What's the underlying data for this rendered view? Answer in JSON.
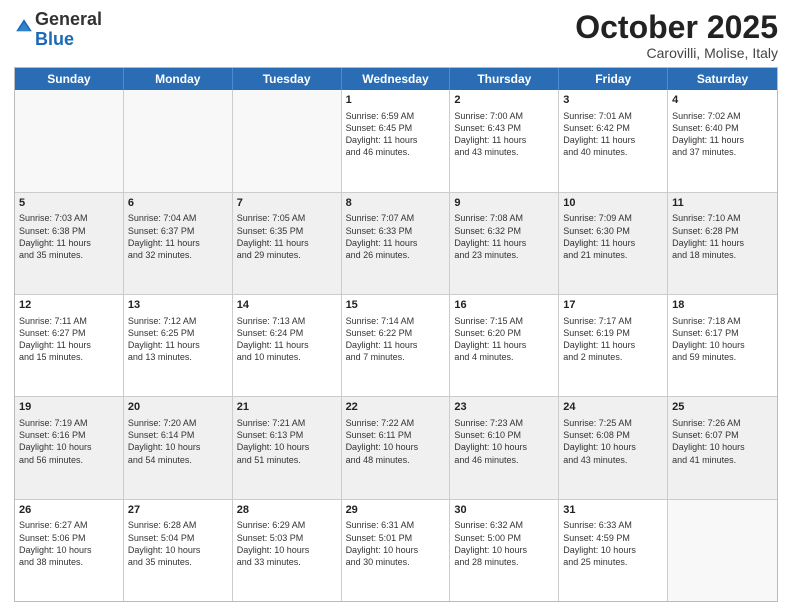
{
  "logo": {
    "general": "General",
    "blue": "Blue"
  },
  "header": {
    "month": "October 2025",
    "location": "Carovilli, Molise, Italy"
  },
  "weekdays": [
    "Sunday",
    "Monday",
    "Tuesday",
    "Wednesday",
    "Thursday",
    "Friday",
    "Saturday"
  ],
  "rows": [
    {
      "shaded": false,
      "cells": [
        {
          "day": "",
          "info": ""
        },
        {
          "day": "",
          "info": ""
        },
        {
          "day": "",
          "info": ""
        },
        {
          "day": "1",
          "info": "Sunrise: 6:59 AM\nSunset: 6:45 PM\nDaylight: 11 hours\nand 46 minutes."
        },
        {
          "day": "2",
          "info": "Sunrise: 7:00 AM\nSunset: 6:43 PM\nDaylight: 11 hours\nand 43 minutes."
        },
        {
          "day": "3",
          "info": "Sunrise: 7:01 AM\nSunset: 6:42 PM\nDaylight: 11 hours\nand 40 minutes."
        },
        {
          "day": "4",
          "info": "Sunrise: 7:02 AM\nSunset: 6:40 PM\nDaylight: 11 hours\nand 37 minutes."
        }
      ]
    },
    {
      "shaded": true,
      "cells": [
        {
          "day": "5",
          "info": "Sunrise: 7:03 AM\nSunset: 6:38 PM\nDaylight: 11 hours\nand 35 minutes."
        },
        {
          "day": "6",
          "info": "Sunrise: 7:04 AM\nSunset: 6:37 PM\nDaylight: 11 hours\nand 32 minutes."
        },
        {
          "day": "7",
          "info": "Sunrise: 7:05 AM\nSunset: 6:35 PM\nDaylight: 11 hours\nand 29 minutes."
        },
        {
          "day": "8",
          "info": "Sunrise: 7:07 AM\nSunset: 6:33 PM\nDaylight: 11 hours\nand 26 minutes."
        },
        {
          "day": "9",
          "info": "Sunrise: 7:08 AM\nSunset: 6:32 PM\nDaylight: 11 hours\nand 23 minutes."
        },
        {
          "day": "10",
          "info": "Sunrise: 7:09 AM\nSunset: 6:30 PM\nDaylight: 11 hours\nand 21 minutes."
        },
        {
          "day": "11",
          "info": "Sunrise: 7:10 AM\nSunset: 6:28 PM\nDaylight: 11 hours\nand 18 minutes."
        }
      ]
    },
    {
      "shaded": false,
      "cells": [
        {
          "day": "12",
          "info": "Sunrise: 7:11 AM\nSunset: 6:27 PM\nDaylight: 11 hours\nand 15 minutes."
        },
        {
          "day": "13",
          "info": "Sunrise: 7:12 AM\nSunset: 6:25 PM\nDaylight: 11 hours\nand 13 minutes."
        },
        {
          "day": "14",
          "info": "Sunrise: 7:13 AM\nSunset: 6:24 PM\nDaylight: 11 hours\nand 10 minutes."
        },
        {
          "day": "15",
          "info": "Sunrise: 7:14 AM\nSunset: 6:22 PM\nDaylight: 11 hours\nand 7 minutes."
        },
        {
          "day": "16",
          "info": "Sunrise: 7:15 AM\nSunset: 6:20 PM\nDaylight: 11 hours\nand 4 minutes."
        },
        {
          "day": "17",
          "info": "Sunrise: 7:17 AM\nSunset: 6:19 PM\nDaylight: 11 hours\nand 2 minutes."
        },
        {
          "day": "18",
          "info": "Sunrise: 7:18 AM\nSunset: 6:17 PM\nDaylight: 10 hours\nand 59 minutes."
        }
      ]
    },
    {
      "shaded": true,
      "cells": [
        {
          "day": "19",
          "info": "Sunrise: 7:19 AM\nSunset: 6:16 PM\nDaylight: 10 hours\nand 56 minutes."
        },
        {
          "day": "20",
          "info": "Sunrise: 7:20 AM\nSunset: 6:14 PM\nDaylight: 10 hours\nand 54 minutes."
        },
        {
          "day": "21",
          "info": "Sunrise: 7:21 AM\nSunset: 6:13 PM\nDaylight: 10 hours\nand 51 minutes."
        },
        {
          "day": "22",
          "info": "Sunrise: 7:22 AM\nSunset: 6:11 PM\nDaylight: 10 hours\nand 48 minutes."
        },
        {
          "day": "23",
          "info": "Sunrise: 7:23 AM\nSunset: 6:10 PM\nDaylight: 10 hours\nand 46 minutes."
        },
        {
          "day": "24",
          "info": "Sunrise: 7:25 AM\nSunset: 6:08 PM\nDaylight: 10 hours\nand 43 minutes."
        },
        {
          "day": "25",
          "info": "Sunrise: 7:26 AM\nSunset: 6:07 PM\nDaylight: 10 hours\nand 41 minutes."
        }
      ]
    },
    {
      "shaded": false,
      "cells": [
        {
          "day": "26",
          "info": "Sunrise: 6:27 AM\nSunset: 5:06 PM\nDaylight: 10 hours\nand 38 minutes."
        },
        {
          "day": "27",
          "info": "Sunrise: 6:28 AM\nSunset: 5:04 PM\nDaylight: 10 hours\nand 35 minutes."
        },
        {
          "day": "28",
          "info": "Sunrise: 6:29 AM\nSunset: 5:03 PM\nDaylight: 10 hours\nand 33 minutes."
        },
        {
          "day": "29",
          "info": "Sunrise: 6:31 AM\nSunset: 5:01 PM\nDaylight: 10 hours\nand 30 minutes."
        },
        {
          "day": "30",
          "info": "Sunrise: 6:32 AM\nSunset: 5:00 PM\nDaylight: 10 hours\nand 28 minutes."
        },
        {
          "day": "31",
          "info": "Sunrise: 6:33 AM\nSunset: 4:59 PM\nDaylight: 10 hours\nand 25 minutes."
        },
        {
          "day": "",
          "info": ""
        }
      ]
    }
  ]
}
